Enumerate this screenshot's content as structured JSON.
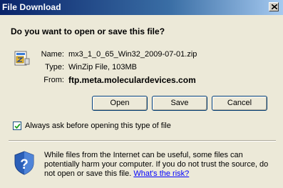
{
  "window": {
    "title": "File Download"
  },
  "dialog": {
    "question": "Do you want to open or save this file?",
    "labels": {
      "name": "Name:",
      "type": "Type:",
      "from": "From:"
    },
    "file": {
      "name": "mx3_1_0_65_Win32_2009-07-01.zip",
      "type": "WinZip File, 103MB",
      "from": "ftp.meta.moleculardevices.com"
    },
    "buttons": {
      "open": "Open",
      "save": "Save",
      "cancel": "Cancel"
    },
    "checkbox": {
      "label": "Always ask before opening this type of file",
      "checked": true
    },
    "warning": {
      "text": "While files from the Internet can be useful, some files can potentially harm your computer. If you do not trust the source, do not open or save this file.",
      "link": "What's the risk?"
    }
  }
}
